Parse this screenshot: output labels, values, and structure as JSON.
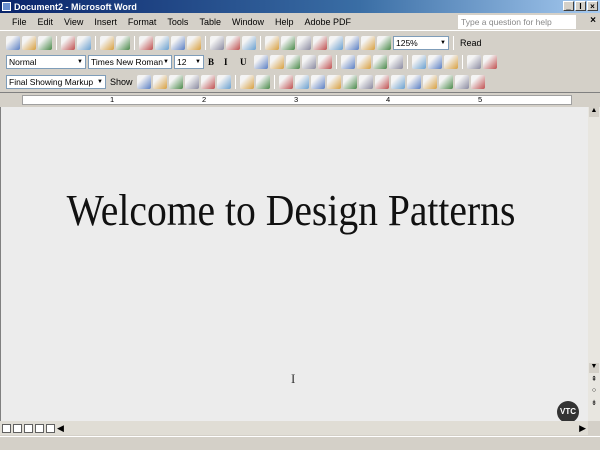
{
  "window": {
    "title": "Document2 - Microsoft Word",
    "controls": [
      "_",
      "Ι",
      "×"
    ]
  },
  "menu": [
    "File",
    "Edit",
    "View",
    "Insert",
    "Format",
    "Tools",
    "Table",
    "Window",
    "Help",
    "Adobe PDF"
  ],
  "help": {
    "placeholder": "Type a question for help",
    "close": "×"
  },
  "standard": {
    "icons": [
      "new-icon",
      "open-icon",
      "save-icon",
      "sep",
      "print-icon",
      "print-preview-icon",
      "sep",
      "spelling-icon",
      "research-icon",
      "sep",
      "cut-icon",
      "copy-icon",
      "paste-icon",
      "format-painter-icon",
      "sep",
      "undo-icon",
      "redo-icon",
      "hyperlink-icon",
      "sep",
      "web-icon",
      "tables-borders-icon",
      "insert-table-icon",
      "excel-icon",
      "columns-icon",
      "drawing-icon",
      "doc-map-icon",
      "show-hide-icon"
    ],
    "zoom": "125%",
    "read": "Read"
  },
  "formatting": {
    "style": "Normal",
    "font": "Times New Roman",
    "size": "12",
    "buttons": [
      "B",
      "I",
      "U"
    ],
    "icons": [
      "align-left-icon",
      "center-icon",
      "align-right-icon",
      "justify-icon",
      "line-spacing-icon",
      "sep",
      "numbering-icon",
      "bullets-icon",
      "decrease-indent-icon",
      "increase-indent-icon",
      "sep",
      "border-icon",
      "highlight-icon",
      "font-color-icon",
      "sep",
      "pdf-icon",
      "pdf-email-icon"
    ]
  },
  "reviewing": {
    "display": "Final Showing Markup",
    "show": "Show",
    "icons": [
      "previous-change-icon",
      "next-change-icon",
      "accept-change-icon",
      "reject-change-icon",
      "comment-icon",
      "highlight-icon",
      "sep",
      "track-changes-icon",
      "reviewing-pane-icon",
      "sep",
      "design-mode-icon",
      "properties-icon",
      "checkbox-icon",
      "textbox-icon",
      "button-icon",
      "option-icon",
      "list-icon",
      "combo-icon",
      "frame-icon",
      "scroll-icon",
      "spin-icon",
      "label-icon",
      "image-icon"
    ]
  },
  "ruler": {
    "numbers": [
      "1",
      "2",
      "3",
      "4",
      "5"
    ]
  },
  "document": {
    "heading": "Welcome to Design Patterns",
    "cursor": "I",
    "watermark": "VTC"
  },
  "colors": {
    "titlebar": "#0a246a",
    "page": "#ececec",
    "chrome": "#d4d0c8"
  }
}
